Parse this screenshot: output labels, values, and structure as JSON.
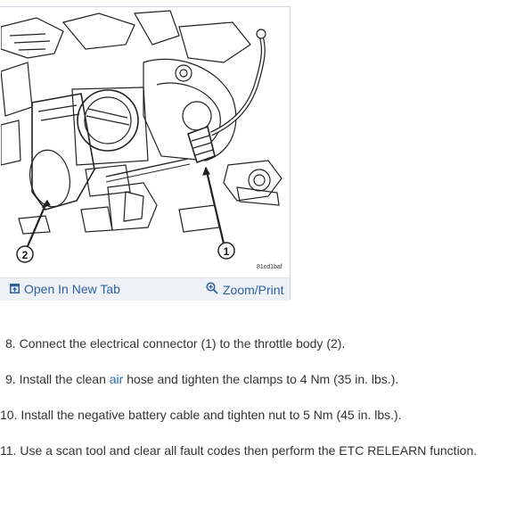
{
  "figure": {
    "callouts": [
      "1",
      "2"
    ],
    "image_code": "81cd1baf",
    "toolbar": {
      "open_label": "Open In New Tab",
      "open_icon": "open-in-new-tab-icon",
      "zoom_label": "Zoom/Print",
      "zoom_icon": "magnifier-plus-icon"
    }
  },
  "steps": [
    {
      "number": "8.",
      "text": "Connect the electrical connector (1) to the throttle body (2)."
    },
    {
      "number": "9.",
      "before": "Install the clean ",
      "link": "air",
      "after": " hose and tighten the clamps to 4 Nm (35 in. lbs.)."
    },
    {
      "number": "10.",
      "text": "Install the negative battery cable and tighten nut to 5 Nm (45 in. lbs.)."
    },
    {
      "number": "11.",
      "text": "Use a scan tool and clear all fault codes then perform the ETC RELEARN function."
    }
  ],
  "colors": {
    "link": "#2b6cb0",
    "toolbar_text": "#2b5f9e",
    "toolbar_bg": "#eef2f7"
  }
}
